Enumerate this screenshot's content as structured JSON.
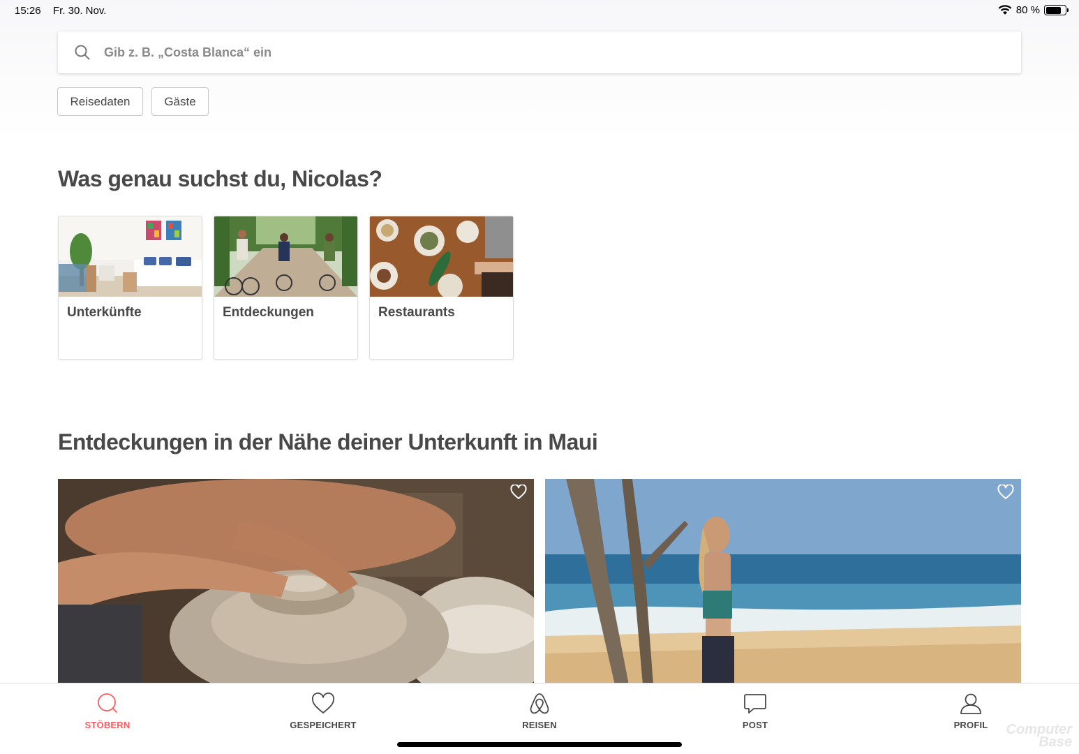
{
  "status_bar": {
    "time": "15:26",
    "date": "Fr. 30. Nov.",
    "battery": "80 %",
    "battery_level": 0.8
  },
  "search": {
    "placeholder": "Gib z. B. „Costa Blanca“ ein"
  },
  "filters": {
    "dates_label": "Reisedaten",
    "guests_label": "Gäste"
  },
  "section_categories": {
    "title": "Was genau suchst du, Nicolas?",
    "items": [
      {
        "label": "Unterkünfte",
        "image": "bedroom-photo"
      },
      {
        "label": "Entdeckungen",
        "image": "cyclists-photo"
      },
      {
        "label": "Restaurants",
        "image": "dining-table-photo"
      }
    ]
  },
  "section_experiences": {
    "title": "Entdeckungen in der Nähe deiner Unterkunft in Maui",
    "items": [
      {
        "image": "pottery-wheel-photo",
        "icon": "heart-outline-icon"
      },
      {
        "image": "beach-yoga-photo",
        "icon": "heart-outline-icon"
      }
    ]
  },
  "tab_bar": {
    "items": [
      {
        "label": "STÖBERN",
        "icon": "search-icon",
        "active": true
      },
      {
        "label": "GESPEICHERT",
        "icon": "heart-icon",
        "active": false
      },
      {
        "label": "REISEN",
        "icon": "airbnb-logo-icon",
        "active": false
      },
      {
        "label": "POST",
        "icon": "message-icon",
        "active": false
      },
      {
        "label": "PROFIL",
        "icon": "profile-icon",
        "active": false
      }
    ]
  },
  "watermark": {
    "line1": "Computer",
    "line2": "Base"
  },
  "colors": {
    "accent": "#ff5a5f",
    "text": "#484848",
    "muted": "#767676"
  }
}
